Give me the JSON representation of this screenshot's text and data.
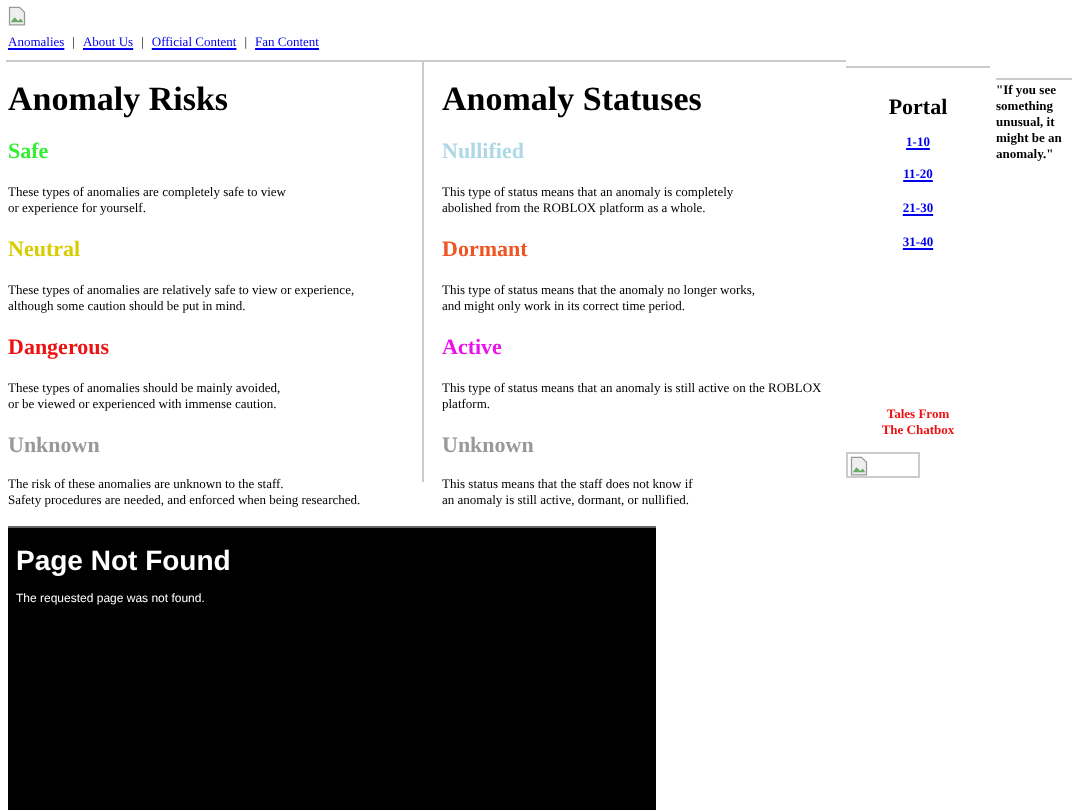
{
  "nav": [
    "Anomalies",
    "About Us",
    "Official Content",
    "Fan Content"
  ],
  "nav_separator": "|",
  "risks": {
    "title": "Anomaly Risks",
    "items": [
      {
        "name": "Safe",
        "color": "#33ee33",
        "text": "These types of anomalies are completely safe to view\nor experience for yourself."
      },
      {
        "name": "Neutral",
        "color": "#d8cc00",
        "text": "These types of anomalies are relatively safe to view or experience,\nalthough some caution should be put in mind."
      },
      {
        "name": "Dangerous",
        "color": "#ee1111",
        "text": "These types of anomalies should be mainly avoided,\nor be viewed or experienced with immense caution."
      },
      {
        "name": "Unknown",
        "color": "#999999",
        "text": "The risk of these anomalies are unknown to the staff.\nSafety procedures are needed, and enforced when being researched."
      }
    ]
  },
  "statuses": {
    "title": "Anomaly Statuses",
    "items": [
      {
        "name": "Nullified",
        "color": "#add8e6",
        "text": "This type of status means that an anomaly is completely\nabolished from the ROBLOX platform as a whole."
      },
      {
        "name": "Dormant",
        "color": "#ee5522",
        "text": "This type of status means that the anomaly no longer works,\nand might only work in its correct time period."
      },
      {
        "name": "Active",
        "color": "#ee11ee",
        "text": "This type of status means that an anomaly is still active on the ROBLOX platform."
      },
      {
        "name": "Unknown",
        "color": "#999999",
        "text": "This status means that the staff does not know if\nan anomaly is still active, dormant, or nullified."
      }
    ]
  },
  "portal": {
    "title": "Portal",
    "links": [
      "1-10",
      "11-20",
      "21-30",
      "31-40"
    ],
    "tales": "Tales From The Chatbox"
  },
  "quote": "\"If you see something unusual, it might be an anomaly.\"",
  "error": {
    "title": "Page Not Found",
    "message": "The requested page was not found."
  }
}
